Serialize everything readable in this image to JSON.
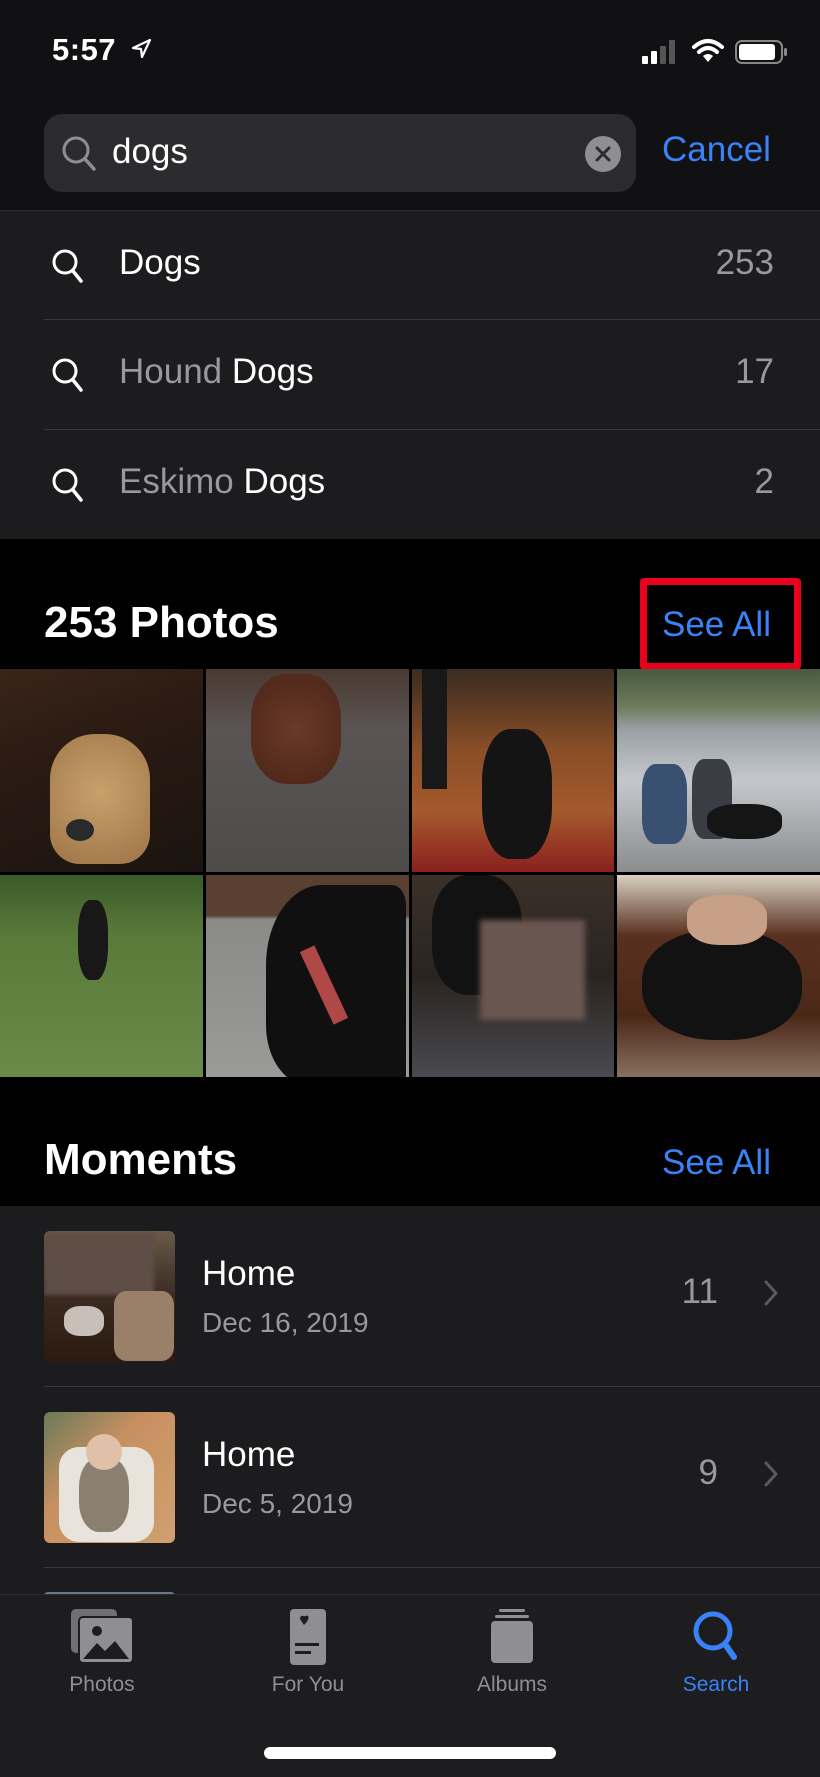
{
  "status_bar": {
    "time": "5:57",
    "icons": [
      "location-arrow-icon",
      "cellular-signal-icon",
      "wifi-icon",
      "battery-icon"
    ]
  },
  "search": {
    "query": "dogs",
    "icon": "magnifier-icon",
    "clear_icon": "clear-x-icon",
    "cancel_label": "Cancel"
  },
  "suggestions": [
    {
      "prefix": "",
      "highlight": "Dogs",
      "count": "253"
    },
    {
      "prefix": "Hound ",
      "highlight": "Dogs",
      "count": "17"
    },
    {
      "prefix": "Eskimo ",
      "highlight": "Dogs",
      "count": "2"
    }
  ],
  "photos_section": {
    "title": "253 Photos",
    "see_all_label": "See All",
    "highlight_color": "#e8001c",
    "photos": [
      {
        "description": "tan dog sitting by wooden desk"
      },
      {
        "description": "brown dog on grey carpet"
      },
      {
        "description": "black dog playing tug on rug"
      },
      {
        "description": "two people with black dogs by rapids"
      },
      {
        "description": "black dog walking on grass"
      },
      {
        "description": "black dog with red collar on carpet"
      },
      {
        "description": "black dog with person, face blurred"
      },
      {
        "description": "black dog lying on couch with person"
      }
    ]
  },
  "moments_section": {
    "title": "Moments",
    "see_all_label": "See All",
    "items": [
      {
        "title": "Home",
        "date": "Dec 16, 2019",
        "count": "11"
      },
      {
        "title": "Home",
        "date": "Dec 5, 2019",
        "count": "9"
      }
    ]
  },
  "tab_bar": {
    "tabs": [
      {
        "label": "Photos",
        "icon": "photos-icon",
        "active": false
      },
      {
        "label": "For You",
        "icon": "for-you-icon",
        "active": false
      },
      {
        "label": "Albums",
        "icon": "albums-icon",
        "active": false
      },
      {
        "label": "Search",
        "icon": "search-icon",
        "active": true
      }
    ]
  },
  "colors": {
    "accent": "#3a82f7",
    "background": "#000000",
    "surface": "#1c1c1e",
    "secondary_text": "#98989d"
  }
}
